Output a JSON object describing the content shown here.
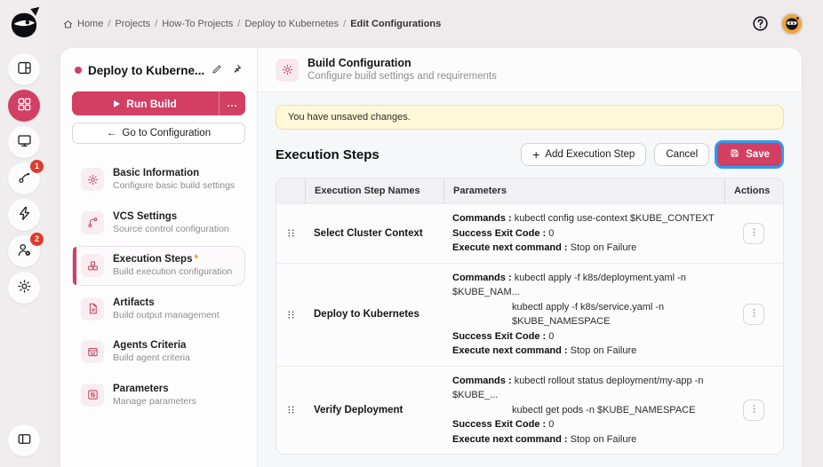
{
  "colors": {
    "brand": "#d23f63",
    "badge": "#e03a2e",
    "focus_ring": "#2f9af0",
    "banner_bg": "#fdf8d7",
    "banner_border": "#ede1a3"
  },
  "rail": {
    "items": [
      "logo",
      "dashboard",
      "projects",
      "agents-monitor",
      "pipelines",
      "activity",
      "users",
      "settings",
      "collapse-sidebar"
    ],
    "active_item": "projects",
    "badges": {
      "pipelines": "1",
      "users": "2"
    }
  },
  "breadcrumb": {
    "items": [
      "Home",
      "Projects",
      "How-To Projects",
      "Deploy to Kubernetes",
      "Edit Configurations"
    ],
    "separator": "/"
  },
  "sidebar": {
    "project_name": "Deploy to Kuberne...",
    "run_build_label": "Run Build",
    "run_more": "...",
    "go_to_arrow": "←",
    "go_to_label": "Go to Configuration",
    "required_marker": "*",
    "nav": [
      {
        "icon": "gear-icon",
        "title": "Basic Information",
        "subtitle": "Configure basic build settings",
        "active": false,
        "required": false
      },
      {
        "icon": "branch-icon",
        "title": "VCS Settings",
        "subtitle": "Source control configuration",
        "active": false,
        "required": false
      },
      {
        "icon": "blocks-icon",
        "title": "Execution Steps",
        "subtitle": "Build execution configuration",
        "active": true,
        "required": true
      },
      {
        "icon": "file-icon",
        "title": "Artifacts",
        "subtitle": "Build output management",
        "active": false,
        "required": false
      },
      {
        "icon": "agent-card-icon",
        "title": "Agents Criteria",
        "subtitle": "Build agent criteria",
        "active": false,
        "required": false
      },
      {
        "icon": "sliders-icon",
        "title": "Parameters",
        "subtitle": "Manage parameters",
        "active": false,
        "required": false
      }
    ]
  },
  "main": {
    "header_title": "Build Configuration",
    "header_subtitle": "Configure build settings and requirements",
    "banner": "You have unsaved changes.",
    "section_title": "Execution Steps",
    "buttons": {
      "add_plus": "+",
      "add": "Add Execution Step",
      "cancel": "Cancel",
      "save": "Save"
    },
    "table": {
      "columns": [
        "Execution Step Names",
        "Parameters",
        "Actions"
      ],
      "steps": [
        {
          "name": "Select Cluster Context",
          "params": [
            {
              "label": "Commands :",
              "text": "kubectl config use-context $KUBE_CONTEXT",
              "cont": false
            },
            {
              "label": "Success Exit Code :",
              "text": "0",
              "cont": false
            },
            {
              "label": "Execute next command :",
              "text": "Stop on Failure",
              "cont": false
            }
          ]
        },
        {
          "name": "Deploy to Kubernetes",
          "params": [
            {
              "label": "Commands :",
              "text": "kubectl apply -f k8s/deployment.yaml -n $KUBE_NAM...",
              "cont": false
            },
            {
              "label": "",
              "text": "kubectl apply -f k8s/service.yaml -n $KUBE_NAMESPACE",
              "cont": true
            },
            {
              "label": "Success Exit Code :",
              "text": "0",
              "cont": false
            },
            {
              "label": "Execute next command :",
              "text": "Stop on Failure",
              "cont": false
            }
          ]
        },
        {
          "name": "Verify Deployment",
          "params": [
            {
              "label": "Commands :",
              "text": "kubectl rollout status deployment/my-app -n $KUBE_...",
              "cont": false
            },
            {
              "label": "",
              "text": "kubectl get pods -n $KUBE_NAMESPACE",
              "cont": true
            },
            {
              "label": "Success Exit Code :",
              "text": "0",
              "cont": false
            },
            {
              "label": "Execute next command :",
              "text": "Stop on Failure",
              "cont": false
            }
          ]
        }
      ]
    }
  }
}
